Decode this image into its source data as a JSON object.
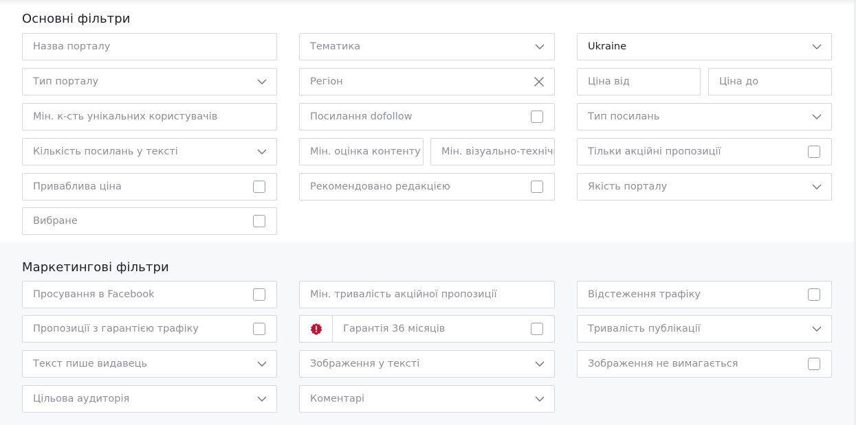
{
  "basic": {
    "title": "Основні фільтри",
    "portal_name_placeholder": "Назва порталу",
    "topic_placeholder": "Тематика",
    "country_value": "Ukraine",
    "portal_type_placeholder": "Тип порталу",
    "region_placeholder": "Регіон",
    "price_from_placeholder": "Ціна від",
    "price_to_placeholder": "Ціна до",
    "min_unique_users_placeholder": "Мін. к-сть унікальних користувачів",
    "dofollow_label": "Посилання dofollow",
    "link_type_placeholder": "Тип посилань",
    "links_in_text_placeholder": "Кількість посилань у тексті",
    "min_content_score_placeholder": "Мін. оцінка контенту",
    "min_visual_score_placeholder": "Мін. візуально-технічн",
    "promo_only_label": "Тільки акційні пропозиції",
    "attractive_price_label": "Приваблива ціна",
    "editor_recommended_label": "Рекомендовано редакцією",
    "portal_quality_placeholder": "Якість порталу",
    "favorites_label": "Вибране"
  },
  "marketing": {
    "title": "Маркетингові фільтри",
    "facebook_promo_label": "Просування в Facebook",
    "min_promo_duration_placeholder": "Мін. тривалість акційної пропозиції",
    "traffic_tracking_label": "Відстеження трафіку",
    "traffic_guarantee_label": "Пропозиції з гарантією трафіку",
    "guarantee_36_label": "Гарантія 36 місяців",
    "publication_duration_placeholder": "Тривалість публікації",
    "publisher_writes_placeholder": "Текст пише видавець",
    "images_in_text_placeholder": "Зображення у тексті",
    "image_not_required_label": "Зображення не вимагається",
    "target_audience_placeholder": "Цільова аудиторія",
    "comments_placeholder": "Коментарі"
  },
  "icons": {
    "chevron": "chevron-down-icon",
    "checkbox": "checkbox",
    "clear": "close-icon",
    "badge": "alert-badge-icon"
  },
  "colors": {
    "badge": "#c8102e",
    "border": "#d4d7dc",
    "placeholder": "#8b8f99"
  }
}
